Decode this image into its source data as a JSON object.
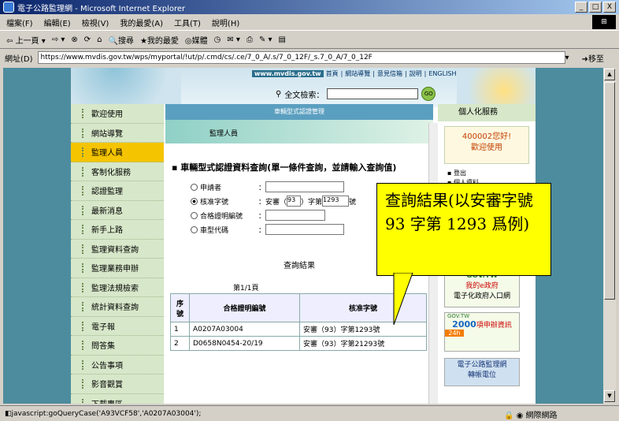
{
  "window": {
    "title": "電子公路監理網 - Microsoft Internet Explorer",
    "controls": [
      "_",
      "□",
      "X"
    ]
  },
  "menubar": [
    "檔案(F)",
    "編輯(E)",
    "檢視(V)",
    "我的最愛(A)",
    "工具(T)",
    "說明(H)"
  ],
  "toolbar": {
    "back": "上一頁",
    "search": "搜尋",
    "favorites": "我的最愛",
    "media": "媒體"
  },
  "address": {
    "label": "網址(D)",
    "url": "https://www.mvdis.gov.tw/wps/myportal/!ut/p/.cmd/cs/.ce/7_0_A/.s/7_0_12F/_s.7_0_A/7_0_12F",
    "go": "移至"
  },
  "header": {
    "logo": "www.mvdis.gov.tw",
    "links": [
      "首頁",
      "網站導覽",
      "意見信箱",
      "說明",
      "ENGLISH"
    ],
    "search_label": "全文檢索：",
    "search_go": "GO"
  },
  "sidebar": {
    "items": [
      "歡迎使用",
      "網站導覽",
      "監理人員",
      "客制化服務",
      "認證監理",
      "最新消息",
      "新手上路",
      "監理資料查詢",
      "監理業務申辦",
      "監理法規檢索",
      "統計資料查詢",
      "電子報",
      "問答集",
      "公告事項",
      "影音觀賞",
      "下載專區"
    ],
    "active_index": 2
  },
  "main": {
    "band": "車輛型式認證管理",
    "subtitle": "監理人員",
    "form_title": "車輛型式認證資料查詢(單一條件查詢，並請輸入查詢值)",
    "fields": [
      {
        "label": "申請者",
        "sep": "："
      },
      {
        "label": "核准字號",
        "sep": "：",
        "prefix": "安審（",
        "v1": "93",
        "mid": "）字第",
        "v2": "1293",
        "suffix": "號"
      },
      {
        "label": "合格證明編號",
        "sep": "："
      },
      {
        "label": "車型代碼",
        "sep": "："
      }
    ],
    "result_title": "查詢結果",
    "page_count": "第1/1頁",
    "table": {
      "headers": [
        "序號",
        "合格證明編號",
        "核准字號"
      ],
      "rows": [
        [
          "1",
          "A0207A03004",
          "安審（93）字第1293號"
        ],
        [
          "2",
          "D0658N0454-20/19",
          "安審（93）字第21293號"
        ]
      ]
    }
  },
  "right": {
    "header": "個人化服務",
    "greeting": "400002您好!",
    "welcome": "歡迎使用",
    "links": [
      "登出",
      "個人資料"
    ],
    "banners": [
      "GOV.TW",
      "我的e政府",
      "電子化政府入口網",
      "GOV.TW",
      "2000",
      "項申辦資訊",
      "24h",
      "電子公路監理網",
      "轉帳電位"
    ]
  },
  "callout": "查詢結果(以安審字號 93 字第 1293 爲例)",
  "status": {
    "text": "javascript:goQueryCase('A93VCF58','A0207A03004');",
    "zone": "網際網路"
  }
}
